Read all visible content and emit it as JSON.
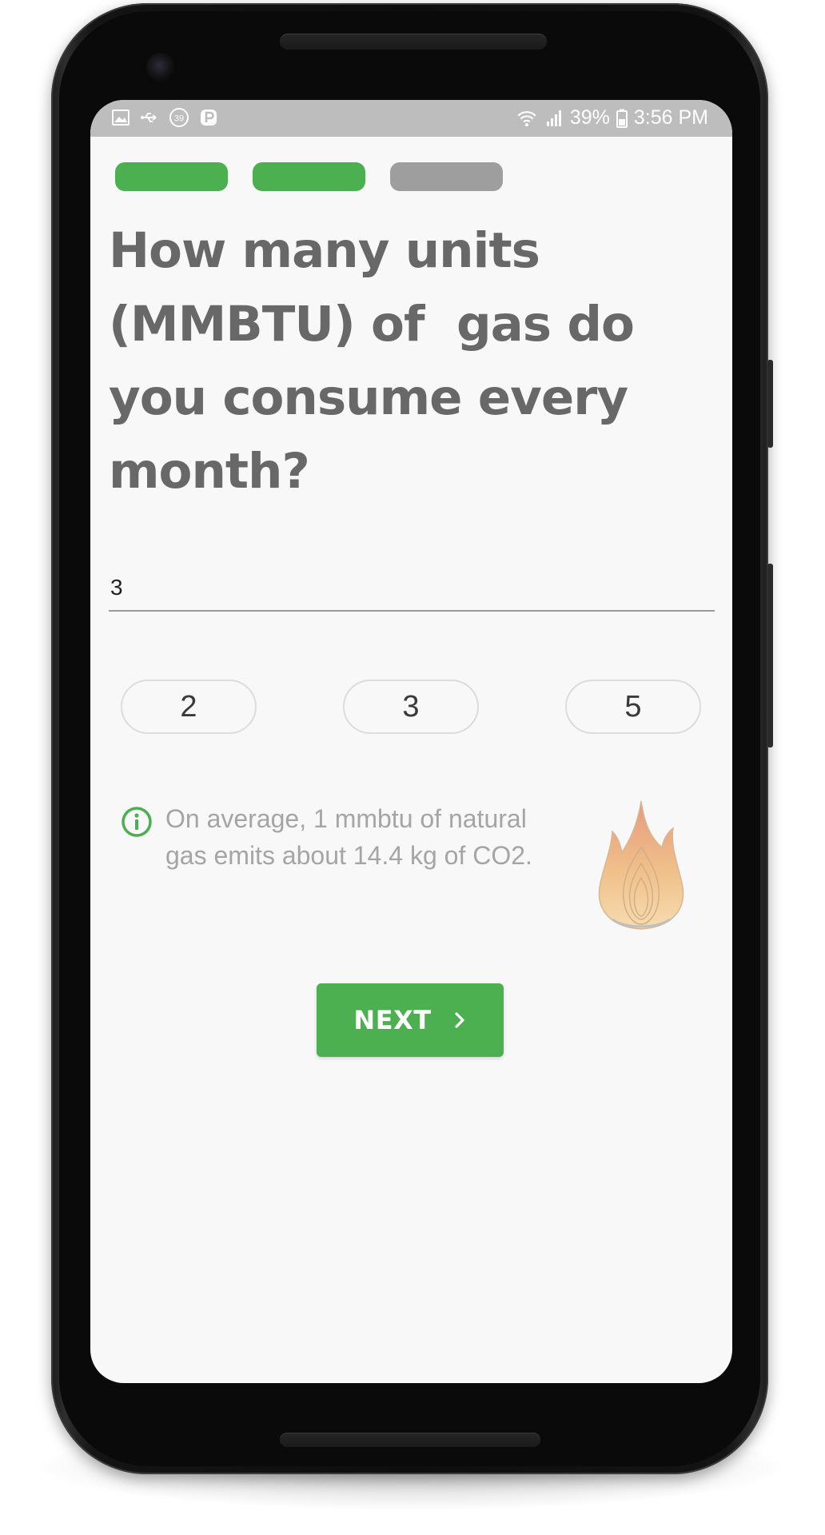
{
  "status_bar": {
    "left_icons": [
      "image-icon",
      "usb-icon",
      "badge-39-icon",
      "p-icon"
    ],
    "badge_number": "39",
    "right_icons": [
      "wifi-icon",
      "signal-icon",
      "battery-icon"
    ],
    "battery": "39%",
    "time": "3:56 PM"
  },
  "progress": {
    "steps": [
      {
        "state": "complete",
        "color": "#4caf50"
      },
      {
        "state": "complete",
        "color": "#4caf50"
      },
      {
        "state": "incomplete",
        "color": "#9e9e9e"
      }
    ]
  },
  "question": {
    "line1": "How many units",
    "line2": "(MMBTU) of  gas do",
    "line3": "you consume every",
    "line4": "month?"
  },
  "answer": {
    "value": "3"
  },
  "quick_options": [
    "2",
    "3",
    "5"
  ],
  "info": {
    "icon": "info-icon",
    "line1": "On average, 1 mmbtu of natural",
    "line2": "gas emits about 14.4 kg of CO2.",
    "illustration": "flame-icon"
  },
  "next_button": {
    "label": "NEXT",
    "icon": "chevron-right-icon",
    "color": "#4caf50"
  }
}
